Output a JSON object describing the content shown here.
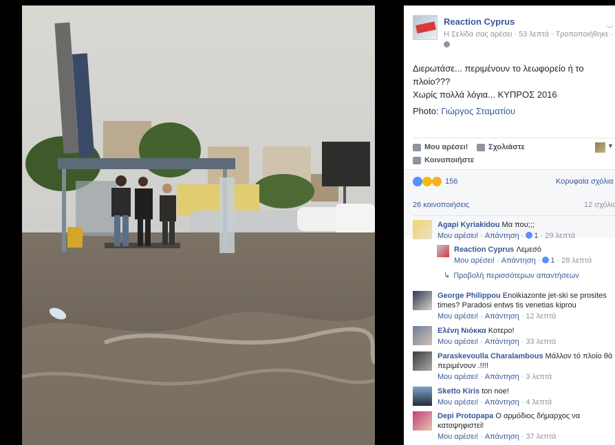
{
  "page": {
    "name": "Reaction Cyprus",
    "meta": "Η Σελίδα σας αρέσει · 53 λεπτά · Τροποποιήθηκε ·"
  },
  "post": {
    "text_lines": [
      "Διερωτάσε... περιμένουν το λεωφορείο ή το",
      "πλοίο???",
      "Χωρίς πολλά λόγια... ΚΥΠΡΟΣ 2016"
    ],
    "credit_prefix": "Photo:",
    "credit_name": "Γιώργος Σταματίου"
  },
  "actions": {
    "like": "Μου αρέσει!",
    "comment": "Σχολιάστε",
    "share": "Κοινοποιήστε"
  },
  "stats": {
    "reaction_count": "156",
    "top_comments": "Κορυφαία σχόλια",
    "shares": "26 κοινοποιήσεις",
    "comments": "12 σχόλια"
  },
  "comments": [
    {
      "author": "Agapi Kyriakidou",
      "text": "Μα που;;;",
      "like": "Μου αρέσει!",
      "reply": "Απάντηση",
      "likes": "1",
      "time": "29 λεπτά"
    },
    {
      "author": "Reaction Cyprus",
      "text": "Λεμεσό",
      "like": "Μου αρέσει!",
      "reply": "Απάντηση",
      "likes": "1",
      "time": "28 λεπτά"
    },
    {
      "author": "George Philippou",
      "text": "Enoikiazonte jet-ski se prosites times? Paradosi entws tis venetias kiprou",
      "like": "Μου αρέσει!",
      "reply": "Απάντηση",
      "time": "12 λεπτά"
    },
    {
      "author": "Ελένη Νιόκκα",
      "text": "Κοτερο!",
      "like": "Μου αρέσει!",
      "reply": "Απάντηση",
      "time": "33 λεπτά"
    },
    {
      "author": "Paraskevoulla Charalambous",
      "text": "Μάλλον τό πλοίο θά περιμένουν .!!!!",
      "like": "Μου αρέσει!",
      "reply": "Απάντηση",
      "time": "3 λεπτά"
    },
    {
      "author": "Sketto Kiris",
      "text": "ton noe!",
      "like": "Μου αρέσει!",
      "reply": "Απάντηση",
      "time": "4 λεπτά"
    },
    {
      "author": "Depi Protopapa",
      "text": "Ο αρμόδιος δήμαρχος να καταψηφιστεί!",
      "like": "Μου αρέσει!",
      "reply": "Απάντηση",
      "time": "37 λεπτά"
    }
  ],
  "more_replies": "Προβολή περισσότερων απαντήσεων",
  "colors": {
    "link": "#365899",
    "meta": "#90949c",
    "text": "#1d2129",
    "water": "#6f6559"
  }
}
